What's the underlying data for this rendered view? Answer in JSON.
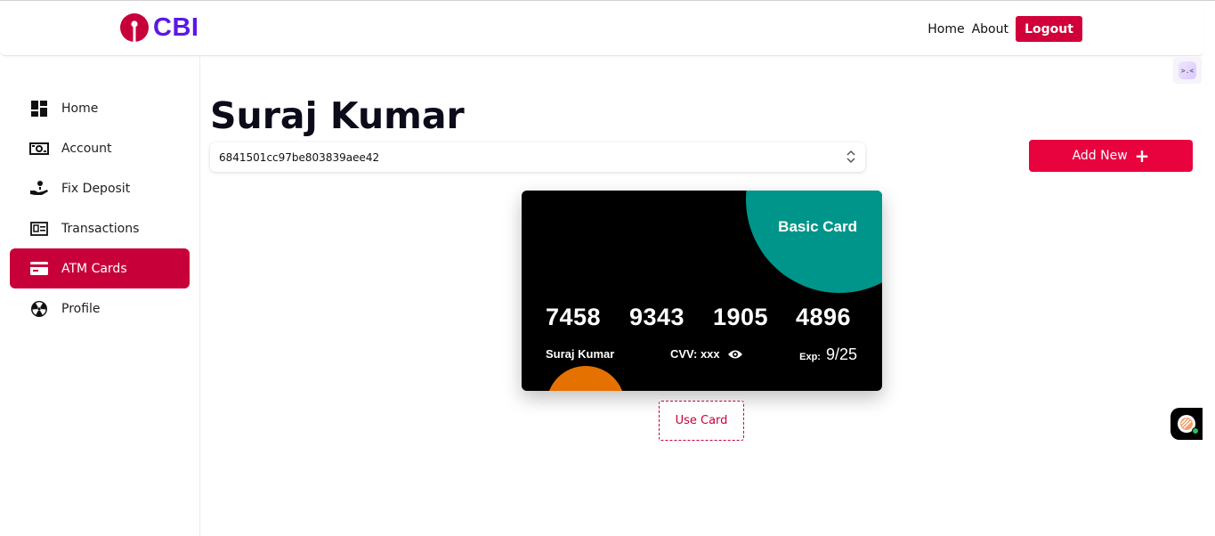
{
  "brand": {
    "name": "CBI",
    "color": "#5b18e6",
    "mark_color": "#c8003a"
  },
  "nav": {
    "home": "Home",
    "about": "About",
    "logout": "Logout"
  },
  "sidebar": {
    "items": [
      {
        "label": "Home",
        "icon": "dashboard-icon",
        "active": false
      },
      {
        "label": "Account",
        "icon": "cash-icon",
        "active": false
      },
      {
        "label": "Fix Deposit",
        "icon": "hand-coin-icon",
        "active": false
      },
      {
        "label": "Transactions",
        "icon": "receipt-icon",
        "active": false
      },
      {
        "label": "ATM Cards",
        "icon": "credit-card-icon",
        "active": true
      },
      {
        "label": "Profile",
        "icon": "radiation-icon",
        "active": false
      }
    ]
  },
  "main": {
    "title": "Suraj Kumar",
    "account_select": {
      "value": "6841501cc97be803839aee42"
    },
    "add_new_label": "Add New",
    "card": {
      "type": "Basic Card",
      "number_groups": [
        "7458",
        "9343",
        "1905",
        "4896"
      ],
      "holder": "Suraj Kumar",
      "cvv_label": "CVV: xxx",
      "exp_label": "Exp:",
      "exp_value": "9/25",
      "colors": {
        "background": "#000000",
        "accent_top": "#00958a",
        "accent_bottom": "#e57100"
      }
    },
    "use_card_label": "Use Card"
  },
  "colors": {
    "primary": "#c8003a",
    "add_button": "#e8033f"
  }
}
